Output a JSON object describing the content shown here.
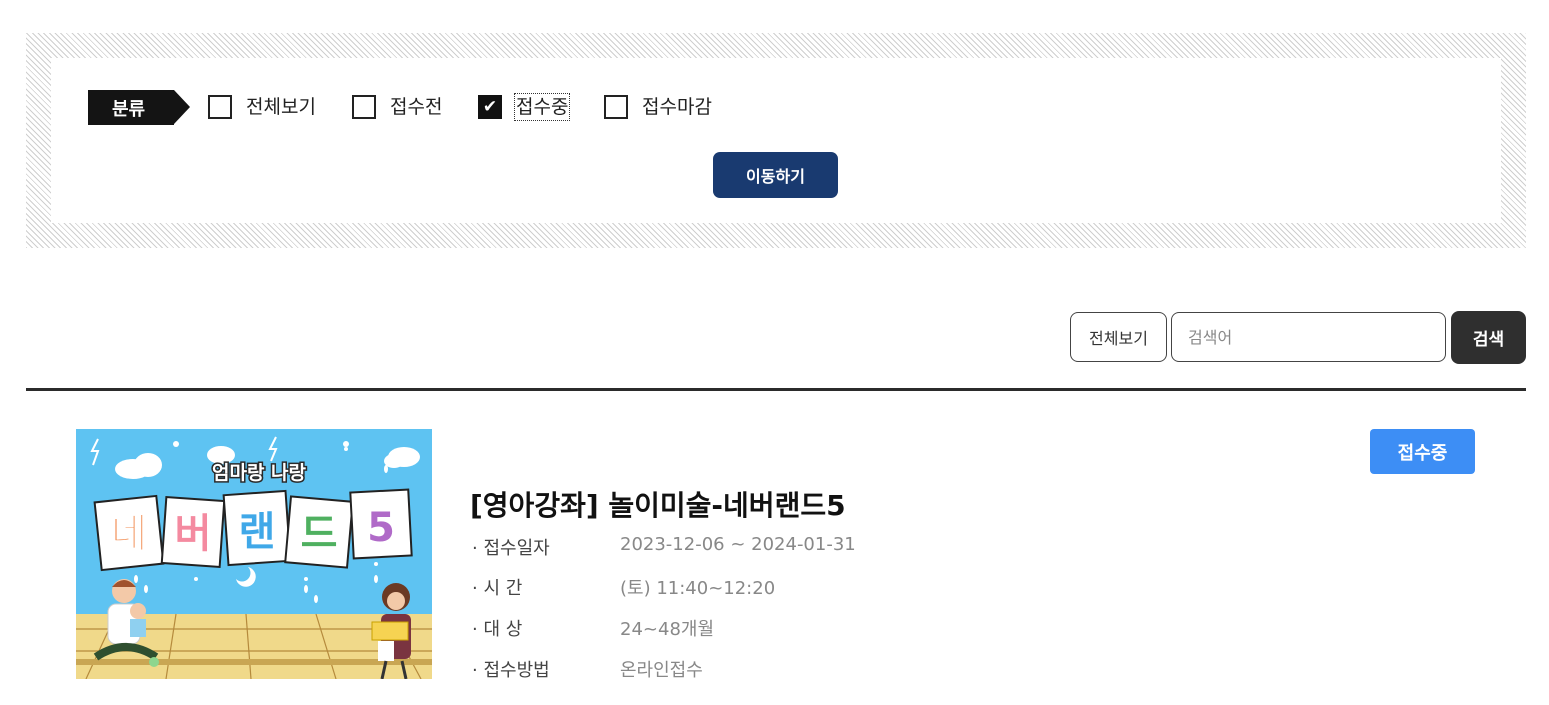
{
  "filter": {
    "category_label": "분류",
    "options": [
      {
        "label": "전체보기",
        "checked": false
      },
      {
        "label": "접수전",
        "checked": false
      },
      {
        "label": "접수중",
        "checked": true
      },
      {
        "label": "접수마감",
        "checked": false
      }
    ],
    "move_label": "이동하기"
  },
  "search": {
    "view_all_label": "전체보기",
    "placeholder": "검색어",
    "button_label": "검색"
  },
  "item": {
    "status": "접수중",
    "status_color": "#3d8ef5",
    "title": "[영아강좌] 놀이미술-네버랜드5",
    "thumbnail": {
      "subtitle": "엄마랑 나랑",
      "letters": [
        "네",
        "버",
        "랜",
        "드",
        "5"
      ]
    },
    "details": [
      {
        "label": "· 접수일자",
        "value": "2023-12-06 ~ 2024-01-31"
      },
      {
        "label": "· 시 간",
        "value": "(토) 11:40~12:20"
      },
      {
        "label": "· 대 상",
        "value": "24~48개월"
      },
      {
        "label": "· 접수방법",
        "value": "온라인접수"
      }
    ]
  },
  "colors": {
    "move_button": "#193a70",
    "search_button": "#2f2f2f"
  }
}
